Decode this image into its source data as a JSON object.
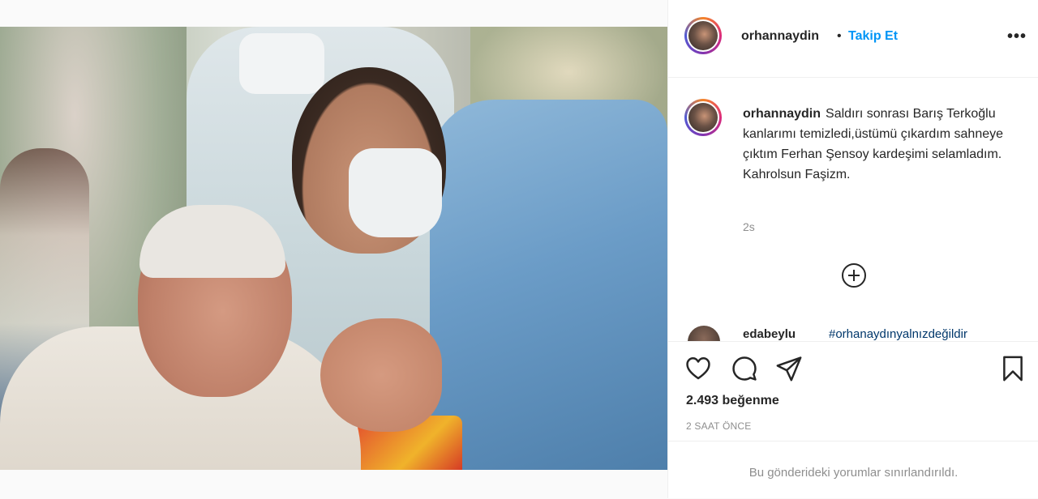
{
  "post": {
    "username": "orhannaydin",
    "separator": "•",
    "follow_label": "Takip Et",
    "more_label": "•••",
    "caption": "Saldırı sonrası Barış Terkoğlu kanlarımı temizledi,üstümü çıkardım sahneye çıktım Ferhan Şensoy kardeşimi selamladım. Kahrolsun Faşizm.",
    "caption_age": "2s",
    "comment_username": "edabeylu",
    "comment_text": "#orhanaydınyalnızdeğildir",
    "likes": "2.493 beğenme",
    "date": "2 SAAT ÖNCE",
    "comments_limited": "Bu gönderideki yorumlar sınırlandırıldı."
  },
  "icons": {
    "like": "heart-icon",
    "comment": "comment-icon",
    "share": "paper-plane-icon",
    "save": "bookmark-icon",
    "load_more": "plus-circle-icon",
    "more": "more-options-icon"
  },
  "colors": {
    "accent": "#0095f6",
    "text": "#262626",
    "muted": "#8e8e8e",
    "hashtag": "#00376b"
  }
}
